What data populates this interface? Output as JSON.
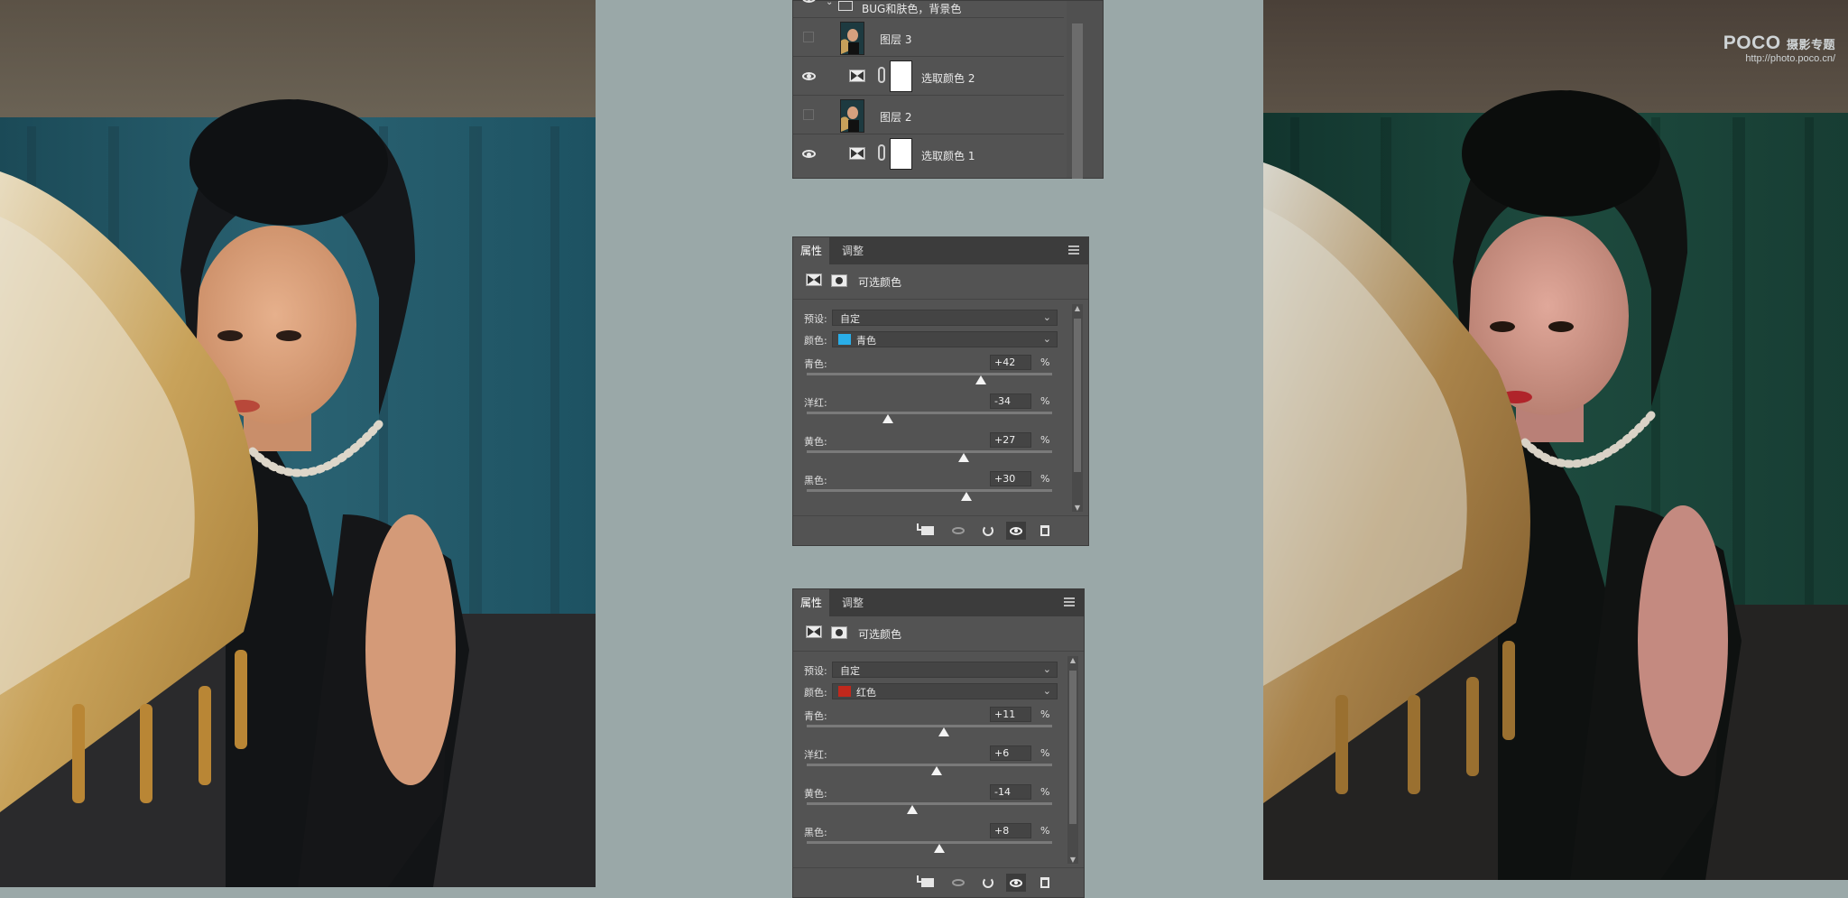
{
  "watermark": {
    "brand": "POCO",
    "brand_suffix": "摄影专题",
    "url": "http://photo.poco.cn/"
  },
  "layers_panel": {
    "group_name": "BUG和肤色，背景色",
    "layers": [
      {
        "name": "图层 3",
        "visible": false,
        "type": "photo"
      },
      {
        "name": "选取颜色 2",
        "visible": true,
        "type": "adjustment"
      },
      {
        "name": "图层 2",
        "visible": false,
        "type": "photo"
      },
      {
        "name": "选取颜色 1",
        "visible": true,
        "type": "adjustment"
      }
    ]
  },
  "panels": [
    {
      "tabs": [
        "属性",
        "调整"
      ],
      "title": "可选颜色",
      "preset_label": "预设:",
      "preset_value": "自定",
      "color_label": "颜色:",
      "color_value": "青色",
      "color_swatch": "#29aee8",
      "sliders": [
        {
          "label": "青色:",
          "value": "+42",
          "unit": "%",
          "position": 0.71
        },
        {
          "label": "洋红:",
          "value": "-34",
          "unit": "%",
          "position": 0.33
        },
        {
          "label": "黄色:",
          "value": "+27",
          "unit": "%",
          "position": 0.64
        },
        {
          "label": "黑色:",
          "value": "+30",
          "unit": "%",
          "position": 0.65
        }
      ]
    },
    {
      "tabs": [
        "属性",
        "调整"
      ],
      "title": "可选颜色",
      "preset_label": "预设:",
      "preset_value": "自定",
      "color_label": "颜色:",
      "color_value": "红色",
      "color_swatch": "#c0281c",
      "sliders": [
        {
          "label": "青色:",
          "value": "+11",
          "unit": "%",
          "position": 0.56
        },
        {
          "label": "洋红:",
          "value": "+6",
          "unit": "%",
          "position": 0.53
        },
        {
          "label": "黄色:",
          "value": "-14",
          "unit": "%",
          "position": 0.43
        },
        {
          "label": "黑色:",
          "value": "+8",
          "unit": "%",
          "position": 0.54
        }
      ]
    }
  ],
  "footer_icons": [
    "clip-to-layer-icon",
    "view-previous-icon",
    "reset-icon",
    "toggle-visibility-icon",
    "delete-icon"
  ]
}
